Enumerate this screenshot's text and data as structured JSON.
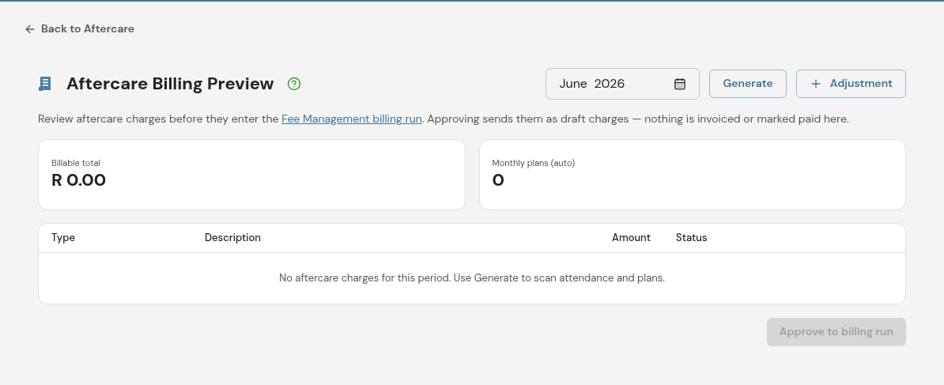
{
  "back_link": {
    "label": "Back to Aftercare"
  },
  "header": {
    "title": "Aftercare Billing Preview",
    "period_field": {
      "value": "June  2026"
    },
    "buttons": [
      {
        "kind": "plain",
        "label": "Generate"
      },
      {
        "kind": "add",
        "label": "Adjustment"
      }
    ]
  },
  "intro": {
    "before": "Review aftercare charges before they enter the ",
    "link": "Fee Management billing run",
    "after": ". Approving sends them as draft charges — nothing is invoiced or marked paid here."
  },
  "stats": [
    {
      "label": "Billable total",
      "value": "R 0.00"
    },
    {
      "label": "Monthly plans (auto)",
      "value": "0"
    }
  ],
  "table": {
    "columns": [
      "Type",
      "Description",
      "Amount",
      "Status"
    ],
    "empty_message": "No aftercare charges for this period. Use Generate to scan attendance and plans."
  },
  "approve_button": {
    "label": "Approve to billing run",
    "disabled": true
  }
}
